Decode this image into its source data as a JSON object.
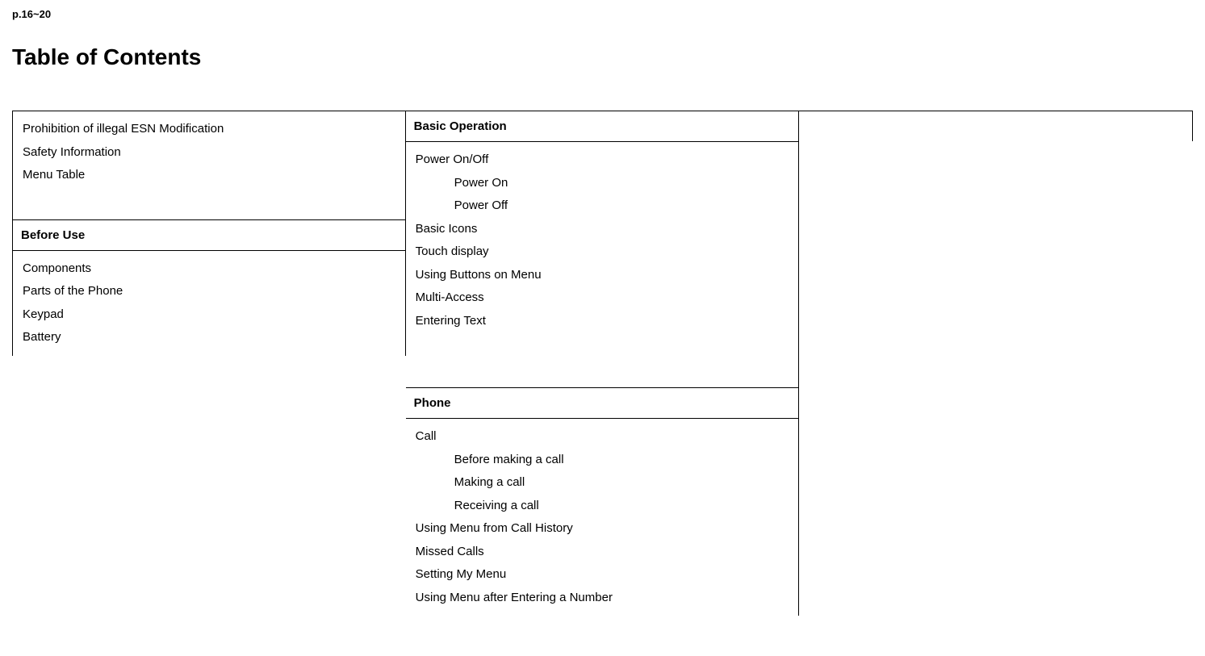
{
  "page_range": "p.16~20",
  "title": "Table of Contents",
  "col1": {
    "top": {
      "items": [
        "Prohibition of illegal ESN Modification",
        "Safety Information",
        "Menu Table"
      ]
    },
    "before_use_header": "Before Use",
    "before_use_items": [
      "Components",
      "Parts of the Phone",
      "Keypad",
      "Battery"
    ]
  },
  "col2": {
    "basic_op_header": "Basic Operation",
    "basic_op": {
      "power": "Power On/Off",
      "power_on": "Power On",
      "power_off": "Power Off",
      "basic_icons": "Basic Icons",
      "touch_display": "Touch display",
      "using_buttons": "Using Buttons on Menu",
      "multi_access": "Multi-Access",
      "entering_text": "Entering Text"
    },
    "phone_header": "Phone",
    "phone": {
      "call": "Call",
      "before_making": "Before making a call",
      "making": "Making a call",
      "receiving": "Receiving a call",
      "using_menu_history": "Using Menu from Call History",
      "missed_calls": "Missed Calls",
      "setting_my_menu": "Setting My Menu",
      "using_menu_after": "Using Menu after Entering a Number"
    }
  }
}
